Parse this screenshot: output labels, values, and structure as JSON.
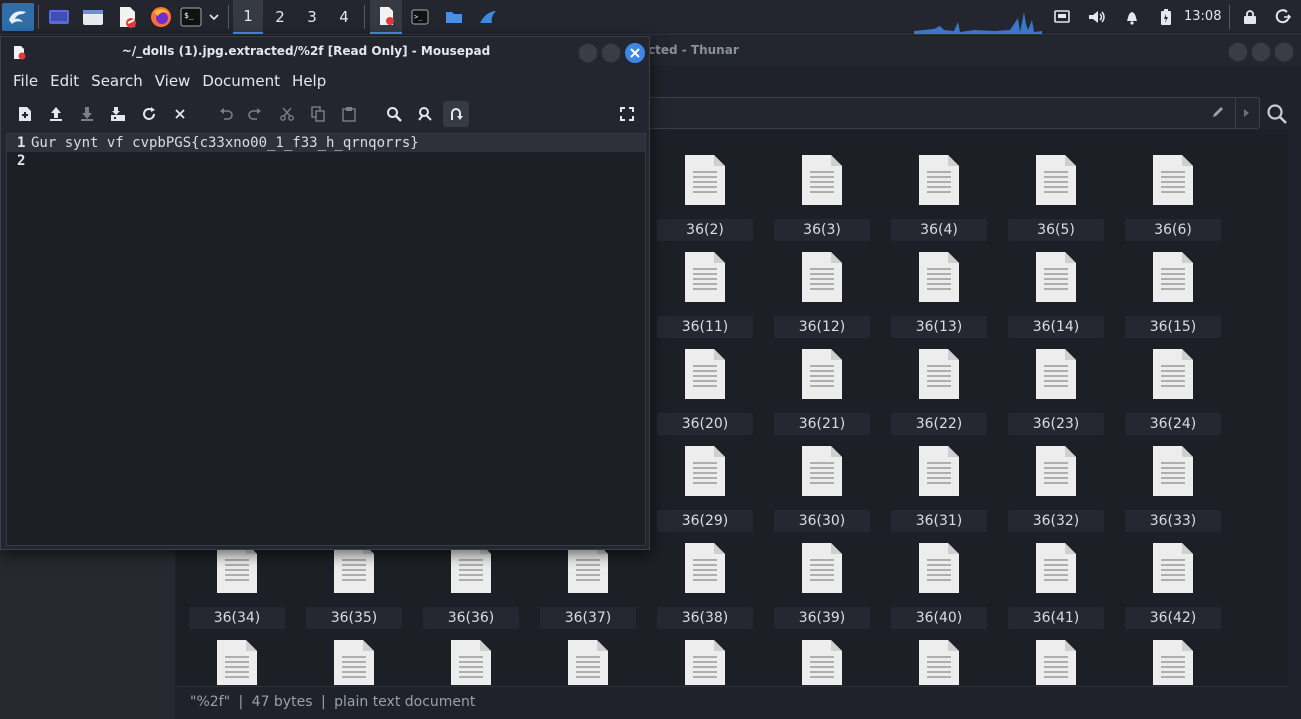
{
  "panel": {
    "workspaces": [
      "1",
      "2",
      "3",
      "4"
    ],
    "active_workspace": "1",
    "clock": "13:08"
  },
  "thunar": {
    "title": "cted - Thunar",
    "statusbar": {
      "name": "\"%2f\"",
      "sep1": "|",
      "size": "47 bytes",
      "sep2": "|",
      "type": "plain text document"
    },
    "files_row1": [
      "36(2)",
      "36(3)",
      "36(4)",
      "36(5)",
      "36(6)"
    ],
    "files_row2": [
      "36(11)",
      "36(12)",
      "36(13)",
      "36(14)",
      "36(15)"
    ],
    "files_row3": [
      "36(20)",
      "36(21)",
      "36(22)",
      "36(23)",
      "36(24)"
    ],
    "files_row4": [
      "36(29)",
      "36(30)",
      "36(31)",
      "36(32)",
      "36(33)"
    ],
    "files_row5": [
      "36(34)",
      "36(35)",
      "36(36)",
      "36(37)",
      "36(38)",
      "36(39)",
      "36(40)",
      "36(41)",
      "36(42)"
    ],
    "files_row6": [
      "",
      "",
      "",
      "",
      "",
      "",
      "",
      "",
      ""
    ]
  },
  "mousepad": {
    "title": "~/_dolls (1).jpg.extracted/%2f [Read Only] - Mousepad",
    "menu": [
      "File",
      "Edit",
      "Search",
      "View",
      "Document",
      "Help"
    ],
    "lines": [
      {
        "num": "1",
        "text": "Gur synt vf cvpbPGS{c33xno00_1_f33_h_qrnqorrs}"
      },
      {
        "num": "2",
        "text": ""
      }
    ]
  }
}
